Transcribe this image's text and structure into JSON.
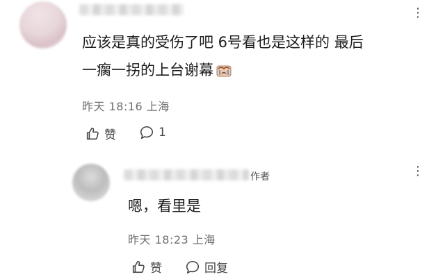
{
  "comment": {
    "text_line1": "应该是真的受伤了吧 6号看也是这样的 最后",
    "text_line2": "一瘸一拐的上台谢幕",
    "emoji": "crying-face-emoji",
    "time": "昨天 18:16 上海",
    "like_label": "赞",
    "reply_count": "1"
  },
  "reply": {
    "author_tag": "作者",
    "text": "嗯，看里是",
    "time": "昨天 18:23 上海",
    "like_label": "赞",
    "reply_label": "回复"
  },
  "more_label": "⋮",
  "icons": {
    "more": "more-vertical-icon",
    "like": "thumbs-up-icon",
    "comment": "comment-bubble-icon"
  },
  "colors": {
    "text": "#1c1c1c",
    "meta": "#6e6e6e",
    "icon": "#444444"
  }
}
